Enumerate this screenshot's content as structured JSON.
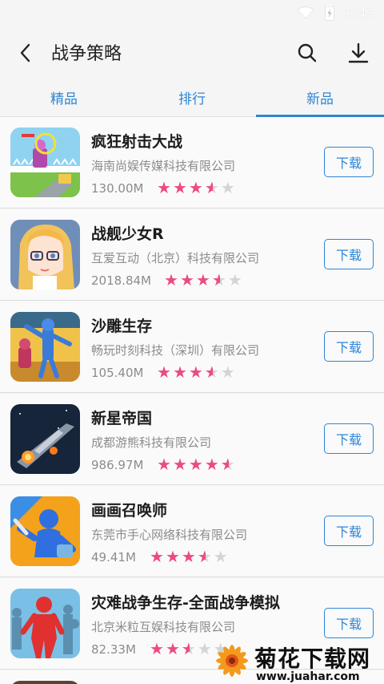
{
  "status_bar": {
    "time": "5:43"
  },
  "header": {
    "title": "战争策略"
  },
  "tabs": [
    {
      "label": "精品"
    },
    {
      "label": "排行"
    },
    {
      "label": "新品",
      "selected": true
    }
  ],
  "download_label": "下载",
  "apps": [
    {
      "name": "疯狂射击大战",
      "company": "海南尚娱传媒科技有限公司",
      "size": "130.00M",
      "rating": 3.5
    },
    {
      "name": "战舰少女R",
      "company": "互爱互动（北京）科技有限公司",
      "size": "2018.84M",
      "rating": 3.5
    },
    {
      "name": "沙雕生存",
      "company": "畅玩时刻科技（深圳）有限公司",
      "size": "105.40M",
      "rating": 3.5
    },
    {
      "name": "新星帝国",
      "company": "成都游熊科技有限公司",
      "size": "986.97M",
      "rating": 4.5
    },
    {
      "name": "画画召唤师",
      "company": "东莞市手心网络科技有限公司",
      "size": "49.41M",
      "rating": 3.5
    },
    {
      "name": "灾难战争生存-全面战争模拟",
      "company": "北京米粒互娱科技有限公司",
      "size": "82.33M",
      "rating": 2.5
    }
  ],
  "watermark": {
    "name": "菊花下载网",
    "url": "www.juahar.com"
  },
  "colors": {
    "accent": "#2e86d6",
    "star": "#ec4a85",
    "star_empty": "#d4d4d4"
  }
}
